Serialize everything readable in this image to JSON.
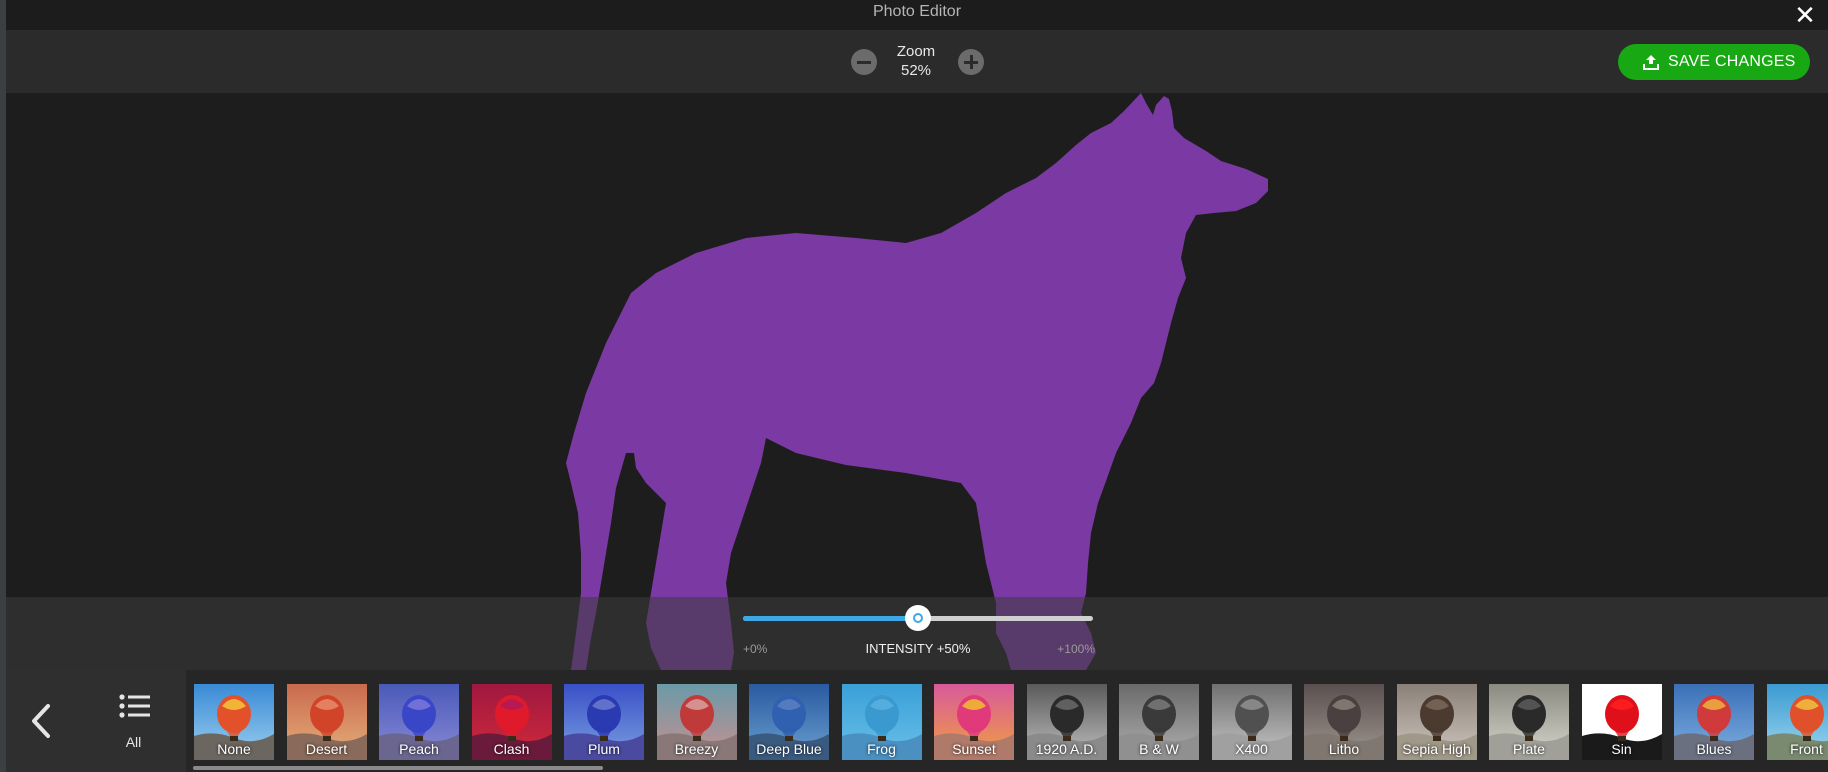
{
  "window": {
    "title": "Photo Editor",
    "close_icon": "close-icon"
  },
  "toolbar": {
    "zoom_label": "Zoom",
    "zoom_value": "52%",
    "save_label": "SAVE CHANGES",
    "save_color": "#17a813"
  },
  "image": {
    "subject_color": "#7b3aa3"
  },
  "intensity": {
    "label": "INTENSITY +50%",
    "min_label": "+0%",
    "max_label": "+100%",
    "value": 0.5,
    "accent_color": "#3ea8e6"
  },
  "bottombar": {
    "back_icon": "chevron-left-icon",
    "all_label": "All",
    "all_icon": "list-icon"
  },
  "filters": [
    {
      "name": "None",
      "sky": "#3a8ad6",
      "sky2": "#9dd0f0",
      "ground": "#6b6660",
      "balloon": "#e2512a",
      "bal2": "#f5c53b"
    },
    {
      "name": "Desert",
      "sky": "#c96a4e",
      "sky2": "#e6b07a",
      "ground": "#8a6a5a",
      "balloon": "#d1442a",
      "bal2": "#e78a6a"
    },
    {
      "name": "Peach",
      "sky": "#4a5ab8",
      "sky2": "#8a8ad8",
      "ground": "#6a6690",
      "balloon": "#3a46c8",
      "bal2": "#7a78d8"
    },
    {
      "name": "Clash",
      "sky": "#a01840",
      "sky2": "#d02a3a",
      "ground": "#6a1a3a",
      "balloon": "#e01a2a",
      "bal2": "#b01a5a"
    },
    {
      "name": "Plum",
      "sky": "#3a50c8",
      "sky2": "#7aa0e0",
      "ground": "#4a4aa0",
      "balloon": "#2a3ab0",
      "bal2": "#6a7ad0"
    },
    {
      "name": "Breezy",
      "sky": "#6a9aa8",
      "sky2": "#c89090",
      "ground": "#8a7878",
      "balloon": "#c03a3a",
      "bal2": "#d8a0a0"
    },
    {
      "name": "Deep Blue",
      "sky": "#2a5aa0",
      "sky2": "#6aa0d0",
      "ground": "#3a5a80",
      "balloon": "#3060b0",
      "bal2": "#5a80c0"
    },
    {
      "name": "Frog",
      "sky": "#3aa0d8",
      "sky2": "#6ac0e8",
      "ground": "#4a90c0",
      "balloon": "#3a9ad0",
      "bal2": "#5ab0e0"
    },
    {
      "name": "Sunset",
      "sky": "#d85a9a",
      "sky2": "#f0a040",
      "ground": "#b07a6a",
      "balloon": "#e03a7a",
      "bal2": "#f0c030"
    },
    {
      "name": "1920 A.D.",
      "sky": "#5a5a5a",
      "sky2": "#c0c0c0",
      "ground": "#8a8a8a",
      "balloon": "#2a2a2a",
      "bal2": "#6a6a6a"
    },
    {
      "name": "B & W",
      "sky": "#6a6a6a",
      "sky2": "#b0b0b0",
      "ground": "#909090",
      "balloon": "#3a3a3a",
      "bal2": "#7a7a7a"
    },
    {
      "name": "X400",
      "sky": "#707070",
      "sky2": "#c8c8c8",
      "ground": "#a0a0a0",
      "balloon": "#505050",
      "bal2": "#909090"
    },
    {
      "name": "Litho",
      "sky": "#5a5050",
      "sky2": "#a09890",
      "ground": "#807870",
      "balloon": "#4a4040",
      "bal2": "#8a8078"
    },
    {
      "name": "Sepia High",
      "sky": "#8a8078",
      "sky2": "#d0c8c0",
      "ground": "#a09888",
      "balloon": "#4a3a30",
      "bal2": "#7a6a5a"
    },
    {
      "name": "Plate",
      "sky": "#8a8a80",
      "sky2": "#d8d8d0",
      "ground": "#a0a098",
      "balloon": "#2a2a2a",
      "bal2": "#5a5a5a"
    },
    {
      "name": "Sin",
      "sky": "#ffffff",
      "sky2": "#ffffff",
      "ground": "#1a1a1a",
      "balloon": "#e0101a",
      "bal2": "#ff2020"
    },
    {
      "name": "Blues",
      "sky": "#3a70b8",
      "sky2": "#80b0e0",
      "ground": "#6a7080",
      "balloon": "#d03a3a",
      "bal2": "#f0b040"
    },
    {
      "name": "Front",
      "sky": "#3a9ad0",
      "sky2": "#a0d8f0",
      "ground": "#7a8a70",
      "balloon": "#e0502a",
      "bal2": "#f0c040"
    }
  ]
}
